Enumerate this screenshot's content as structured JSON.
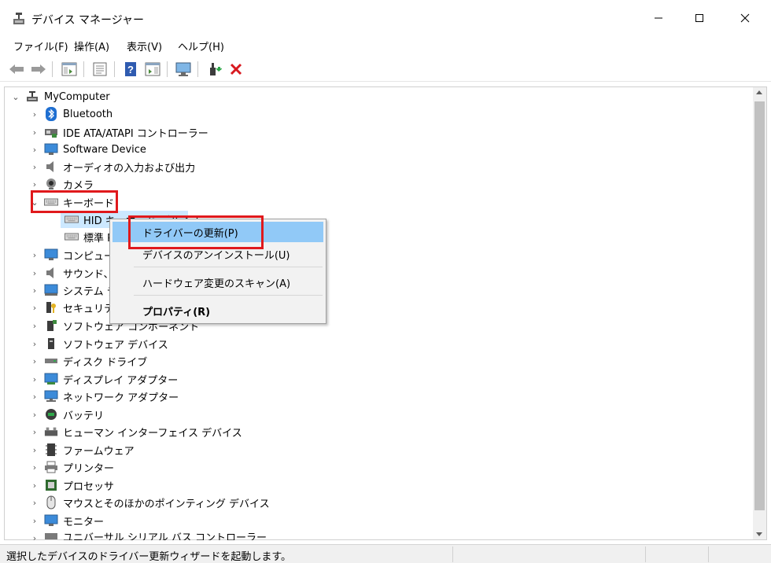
{
  "window": {
    "title": "デバイス マネージャー"
  },
  "menu": {
    "file": "ファイル(F)",
    "action": "操作(A)",
    "view": "表示(V)",
    "help": "ヘルプ(H)"
  },
  "tree": {
    "root": "MyComputer",
    "items": [
      {
        "label": "Bluetooth",
        "icon": "bluetooth-icon"
      },
      {
        "label": "IDE ATA/ATAPI コントローラー",
        "icon": "ide-controller-icon"
      },
      {
        "label": "Software Device",
        "icon": "software-device-icon"
      },
      {
        "label": "オーディオの入力および出力",
        "icon": "speaker-icon"
      },
      {
        "label": "カメラ",
        "icon": "camera-icon"
      },
      {
        "label": "キーボード",
        "icon": "keyboard-icon"
      },
      {
        "label": "HID キーボード デバイス",
        "icon": "keyboard-icon"
      },
      {
        "label": "標準 PS/2 キーボード",
        "icon": "keyboard-icon"
      },
      {
        "label": "コンピューター",
        "icon": "computer-icon"
      },
      {
        "label": "サウンド、ビデオ、およびゲーム コントローラー",
        "icon": "speaker-icon"
      },
      {
        "label": "システム デバイス",
        "icon": "system-device-icon"
      },
      {
        "label": "セキュリティ デバイス",
        "icon": "security-key-icon"
      },
      {
        "label": "ソフトウェア コンポーネント",
        "icon": "software-component-icon"
      },
      {
        "label": "ソフトウェア デバイス",
        "icon": "software-device-icon"
      },
      {
        "label": "ディスク ドライブ",
        "icon": "disk-drive-icon"
      },
      {
        "label": "ディスプレイ アダプター",
        "icon": "display-adapter-icon"
      },
      {
        "label": "ネットワーク アダプター",
        "icon": "network-adapter-icon"
      },
      {
        "label": "バッテリ",
        "icon": "battery-icon"
      },
      {
        "label": "ヒューマン インターフェイス デバイス",
        "icon": "hid-icon"
      },
      {
        "label": "ファームウェア",
        "icon": "firmware-icon"
      },
      {
        "label": "プリンター",
        "icon": "printer-icon"
      },
      {
        "label": "プロセッサ",
        "icon": "processor-icon"
      },
      {
        "label": "マウスとそのほかのポインティング デバイス",
        "icon": "mouse-icon"
      },
      {
        "label": "モニター",
        "icon": "monitor-icon"
      },
      {
        "label": "ユニバーサル シリアル バス コントローラー",
        "icon": "usb-icon"
      }
    ]
  },
  "context_menu": {
    "update_driver": "ドライバーの更新(P)",
    "uninstall": "デバイスのアンインストール(U)",
    "scan": "ハードウェア変更のスキャン(A)",
    "properties": "プロパティ(R)"
  },
  "status": {
    "text": "選択したデバイスのドライバー更新ウィザードを起動します。"
  },
  "colors": {
    "highlight_red": "#e0191c",
    "menu_hover": "#91c9f7",
    "selection": "#cce8ff"
  }
}
